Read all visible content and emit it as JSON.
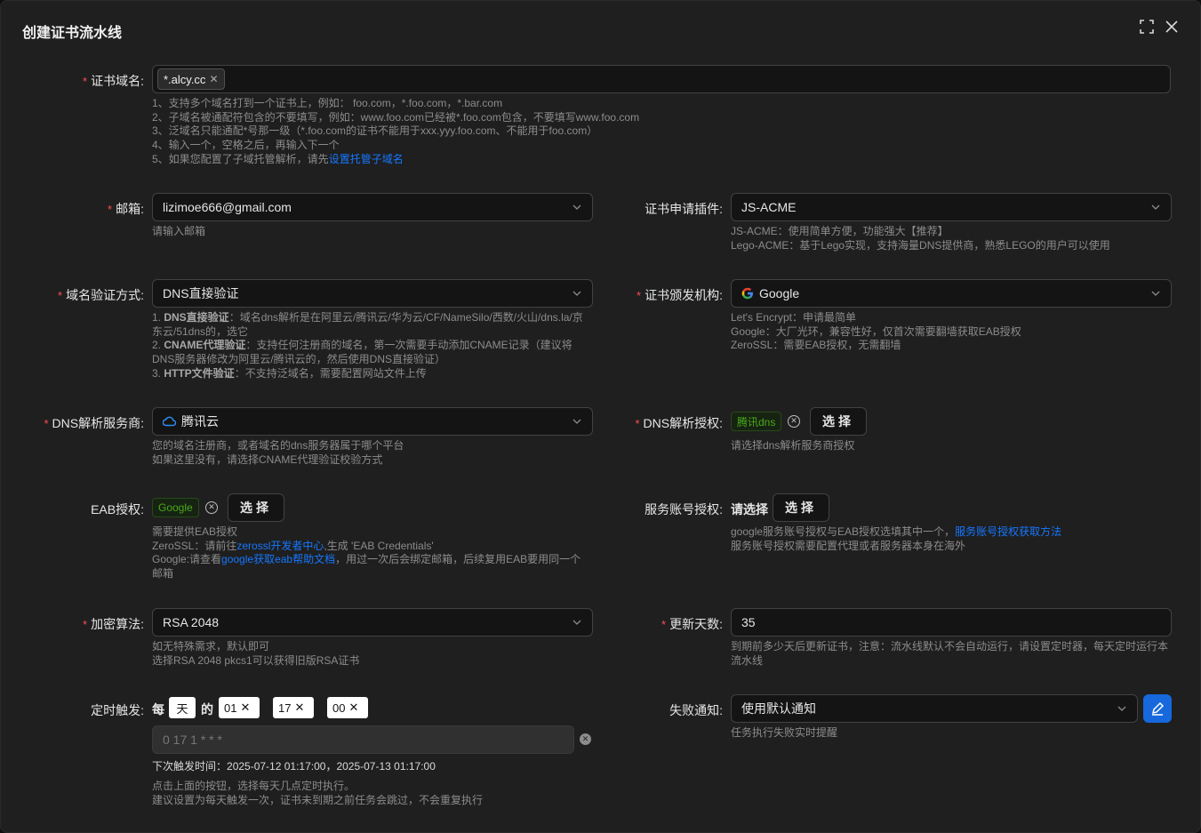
{
  "modal": {
    "title": "创建证书流水线"
  },
  "domain": {
    "label": "证书域名:",
    "tag": "*.alcy.cc",
    "help": [
      "1、支持多个域名打到一个证书上，例如： foo.com，*.foo.com，*.bar.com",
      "2、子域名被通配符包含的不要填写，例如：www.foo.com已经被*.foo.com包含，不要填写www.foo.com",
      "3、泛域名只能通配*号那一级（*.foo.com的证书不能用于xxx.yyy.foo.com、不能用于foo.com）",
      "4、输入一个，空格之后，再输入下一个"
    ],
    "help5_prefix": "5、如果您配置了子域托管解析，请先",
    "help5_link": "设置托管子域名"
  },
  "email": {
    "label": "邮箱:",
    "value": "lizimoe666@gmail.com",
    "help": "请输入邮箱"
  },
  "plugin": {
    "label": "证书申请插件:",
    "value": "JS-ACME",
    "help": [
      "JS-ACME：使用简单方便，功能强大【推荐】",
      "Lego-ACME：基于Lego实现，支持海量DNS提供商，熟悉LEGO的用户可以使用"
    ]
  },
  "verify": {
    "label": "域名验证方式:",
    "value": "DNS直接验证",
    "h1_bold": "DNS直接验证",
    "h1_text": "：域名dns解析是在阿里云/腾讯云/华为云/CF/NameSilo/西数/火山/dns.la/京东云/51dns的，选它",
    "h2_bold": "CNAME代理验证",
    "h2_text": "：支持任何注册商的域名，第一次需要手动添加CNAME记录（建议将DNS服务器修改为阿里云/腾讯云的，然后使用DNS直接验证）",
    "h3_bold": "HTTP文件验证",
    "h3_text": "：不支持泛域名，需要配置网站文件上传",
    "n1": "1. ",
    "n2": "2. ",
    "n3": "3. "
  },
  "ca": {
    "label": "证书颁发机构:",
    "value": "Google",
    "help": [
      "Let's Encrypt：申请最简单",
      "Google：大厂光环，兼容性好，仅首次需要翻墙获取EAB授权",
      "ZeroSSL：需要EAB授权，无需翻墙"
    ]
  },
  "dnsProvider": {
    "label": "DNS解析服务商:",
    "value": "腾讯云",
    "help": [
      "您的域名注册商，或者域名的dns服务器属于哪个平台",
      "如果这里没有，请选择CNAME代理验证校验方式"
    ]
  },
  "dnsAuth": {
    "label": "DNS解析授权:",
    "tag": "腾讯dns",
    "button": "选择",
    "help": "请选择dns解析服务商授权"
  },
  "eab": {
    "label": "EAB授权:",
    "tag": "Google",
    "button": "选择",
    "help1": "需要提供EAB授权",
    "help2_prefix": "ZeroSSL：请前往",
    "help2_link": "zerossl开发者中心",
    "help2_suffix": ",生成 'EAB Credentials'",
    "help3_prefix": "Google:请查看",
    "help3_link": "google获取eab帮助文档",
    "help3_suffix": "，用过一次后会绑定邮箱，后续复用EAB要用同一个邮箱"
  },
  "serviceAccount": {
    "label": "服务账号授权:",
    "placeholder": "请选择",
    "button": "选择",
    "help1_prefix": "google服务账号授权与EAB授权选填其中一个，",
    "help1_link": "服务账号授权获取方法",
    "help2": "服务账号授权需要配置代理或者服务器本身在海外"
  },
  "algo": {
    "label": "加密算法:",
    "value": "RSA 2048",
    "help": [
      "如无特殊需求，默认即可",
      "选择RSA 2048 pkcs1可以获得旧版RSA证书"
    ]
  },
  "renew": {
    "label": "更新天数:",
    "value": "35",
    "help": "到期前多少天后更新证书，注意：流水线默认不会自动运行，请设置定时器，每天定时运行本流水线"
  },
  "schedule": {
    "label": "定时触发:",
    "w_every": "每",
    "unit": "天",
    "w_of": "的",
    "hour": "01",
    "minute": "17",
    "second": "00",
    "cron": "0 17 1 * * *",
    "next_label": "下次触发时间：",
    "next_value": "2025-07-12 01:17:00，2025-07-13 01:17:00",
    "help": [
      "点击上面的按钮，选择每天几点定时执行。",
      "建议设置为每天触发一次，证书未到期之前任务会跳过，不会重复执行"
    ]
  },
  "notify": {
    "label": "失败通知:",
    "value": "使用默认通知",
    "help": "任务执行失败实时提醒"
  },
  "colors": {
    "accent": "#1677ff",
    "required": "#ff4d4f",
    "success": "#49aa19"
  }
}
